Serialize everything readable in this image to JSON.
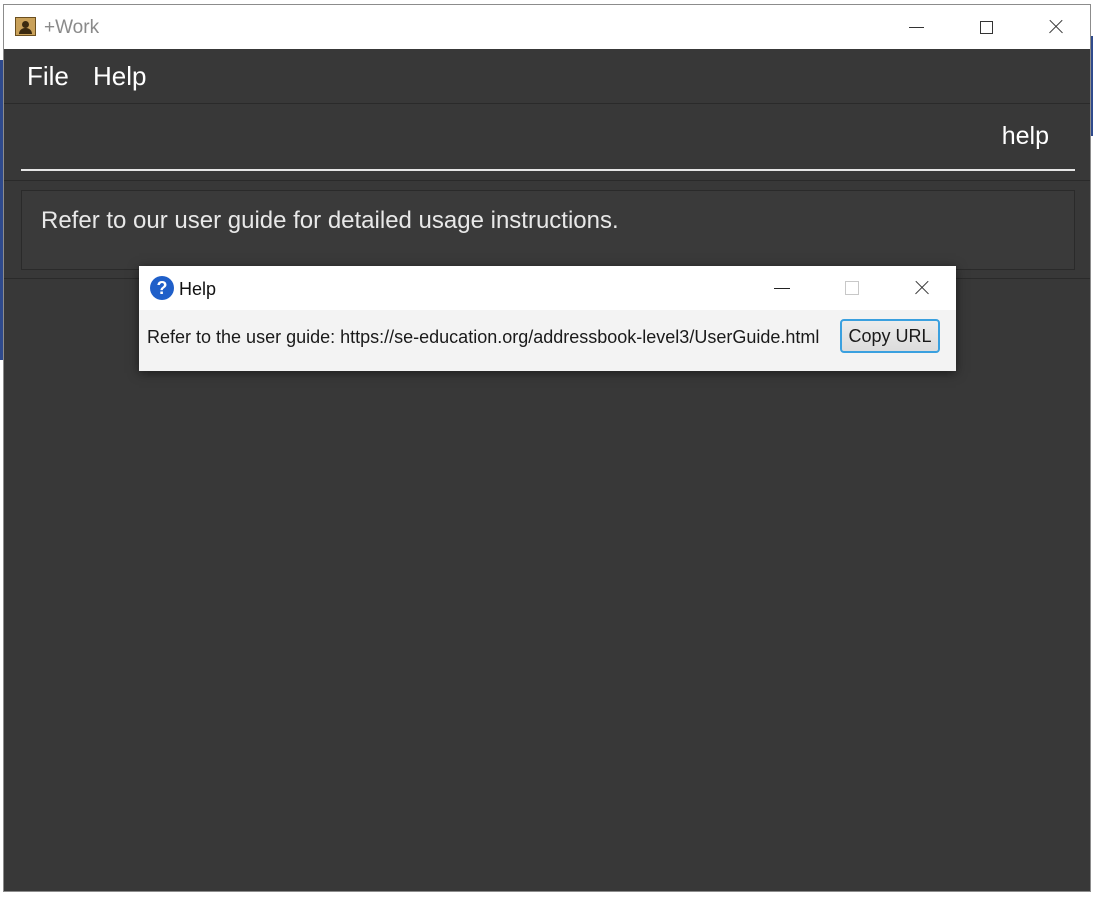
{
  "window": {
    "title": "+Work",
    "icon": "app-icon"
  },
  "menu": {
    "items": [
      {
        "label": "File"
      },
      {
        "label": "Help"
      }
    ]
  },
  "command_box": {
    "value": "help"
  },
  "result_display": {
    "text": "Refer to our user guide for detailed usage instructions."
  },
  "help_dialog": {
    "title": "Help",
    "icon": "question-icon",
    "message": "Refer to the user guide: https://se-education.org/addressbook-level3/UserGuide.html",
    "copy_button_label": "Copy URL",
    "accent_color": "#3aa0df"
  },
  "colors": {
    "window_background": "#383838",
    "help_icon": "#1f5fc9"
  }
}
